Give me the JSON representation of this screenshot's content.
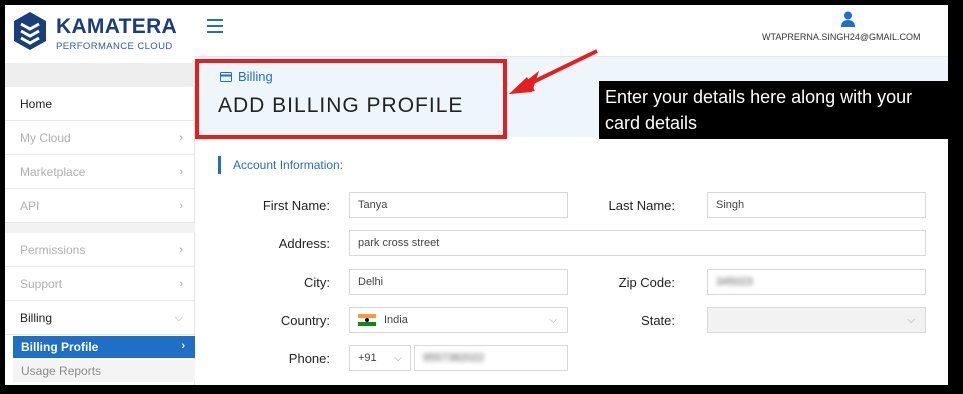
{
  "app": {
    "brand": "KAMATERA",
    "tagline": "PERFORMANCE CLOUD"
  },
  "topbar": {
    "email": "WTAPRERNA.SINGH24@GMAIL.COM"
  },
  "sidebar": {
    "items": [
      {
        "label": "Home"
      },
      {
        "label": "My Cloud"
      },
      {
        "label": "Marketplace"
      },
      {
        "label": "API"
      },
      {
        "label": "Permissions"
      },
      {
        "label": "Support"
      },
      {
        "label": "Billing"
      }
    ],
    "sub_items": [
      {
        "label": "Billing Profile"
      },
      {
        "label": "Usage Reports"
      }
    ]
  },
  "header": {
    "breadcrumb": "Billing",
    "title": "ADD BILLING PROFILE"
  },
  "annotation": {
    "callout": "Enter your details here along with your card details"
  },
  "form": {
    "section_title": "Account Information:",
    "first_name": {
      "label": "First Name:",
      "value": "Tanya"
    },
    "last_name": {
      "label": "Last Name:",
      "value": "Singh"
    },
    "address": {
      "label": "Address:",
      "value": "park cross street"
    },
    "city": {
      "label": "City:",
      "value": "Delhi"
    },
    "zip": {
      "label": "Zip Code:",
      "value": "345023"
    },
    "country": {
      "label": "Country:",
      "value": "India"
    },
    "state": {
      "label": "State:",
      "value": ""
    },
    "phone": {
      "label": "Phone:",
      "code": "+91",
      "value": "9557382022"
    }
  },
  "colors": {
    "accent": "#1f6fc7",
    "highlight": "#e61e1e",
    "header_band": "#eef6fb"
  }
}
